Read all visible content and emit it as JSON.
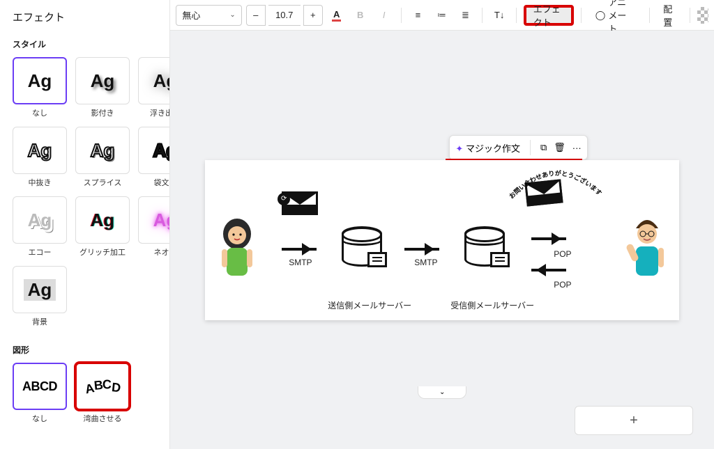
{
  "sidebar": {
    "title": "エフェクト",
    "style_section": "スタイル",
    "shape_section": "図形",
    "styles": [
      {
        "label": "なし"
      },
      {
        "label": "影付き"
      },
      {
        "label": "浮き出し"
      },
      {
        "label": "中抜き"
      },
      {
        "label": "スプライス"
      },
      {
        "label": "袋文字"
      },
      {
        "label": "エコー"
      },
      {
        "label": "グリッチ加工"
      },
      {
        "label": "ネオン"
      },
      {
        "label": "背景"
      }
    ],
    "shapes": [
      {
        "label": "なし"
      },
      {
        "label": "湾曲させる"
      }
    ],
    "sample": "Ag",
    "sample_abcd": "ABCD"
  },
  "toolbar": {
    "font_family": "無心",
    "dec": "–",
    "inc": "+",
    "font_size": "10.7",
    "color_label": "A",
    "bold": "B",
    "italic": "I",
    "spacing": "T↓",
    "effects": "エフェクト",
    "animate": "アニメート",
    "position": "配置"
  },
  "float": {
    "magic": "マジック作文",
    "copy": "⧉",
    "trash": "🗑",
    "more": "···"
  },
  "canvas": {
    "selected_text": "お問い合わせありがとうございます",
    "curved_text": "お問い合わせありがとうございます",
    "smtp": "SMTP",
    "pop": "POP",
    "send_server": "送信側メールサーバー",
    "recv_server": "受信側メールサーバー",
    "add": "+",
    "collapse": "⌄"
  }
}
